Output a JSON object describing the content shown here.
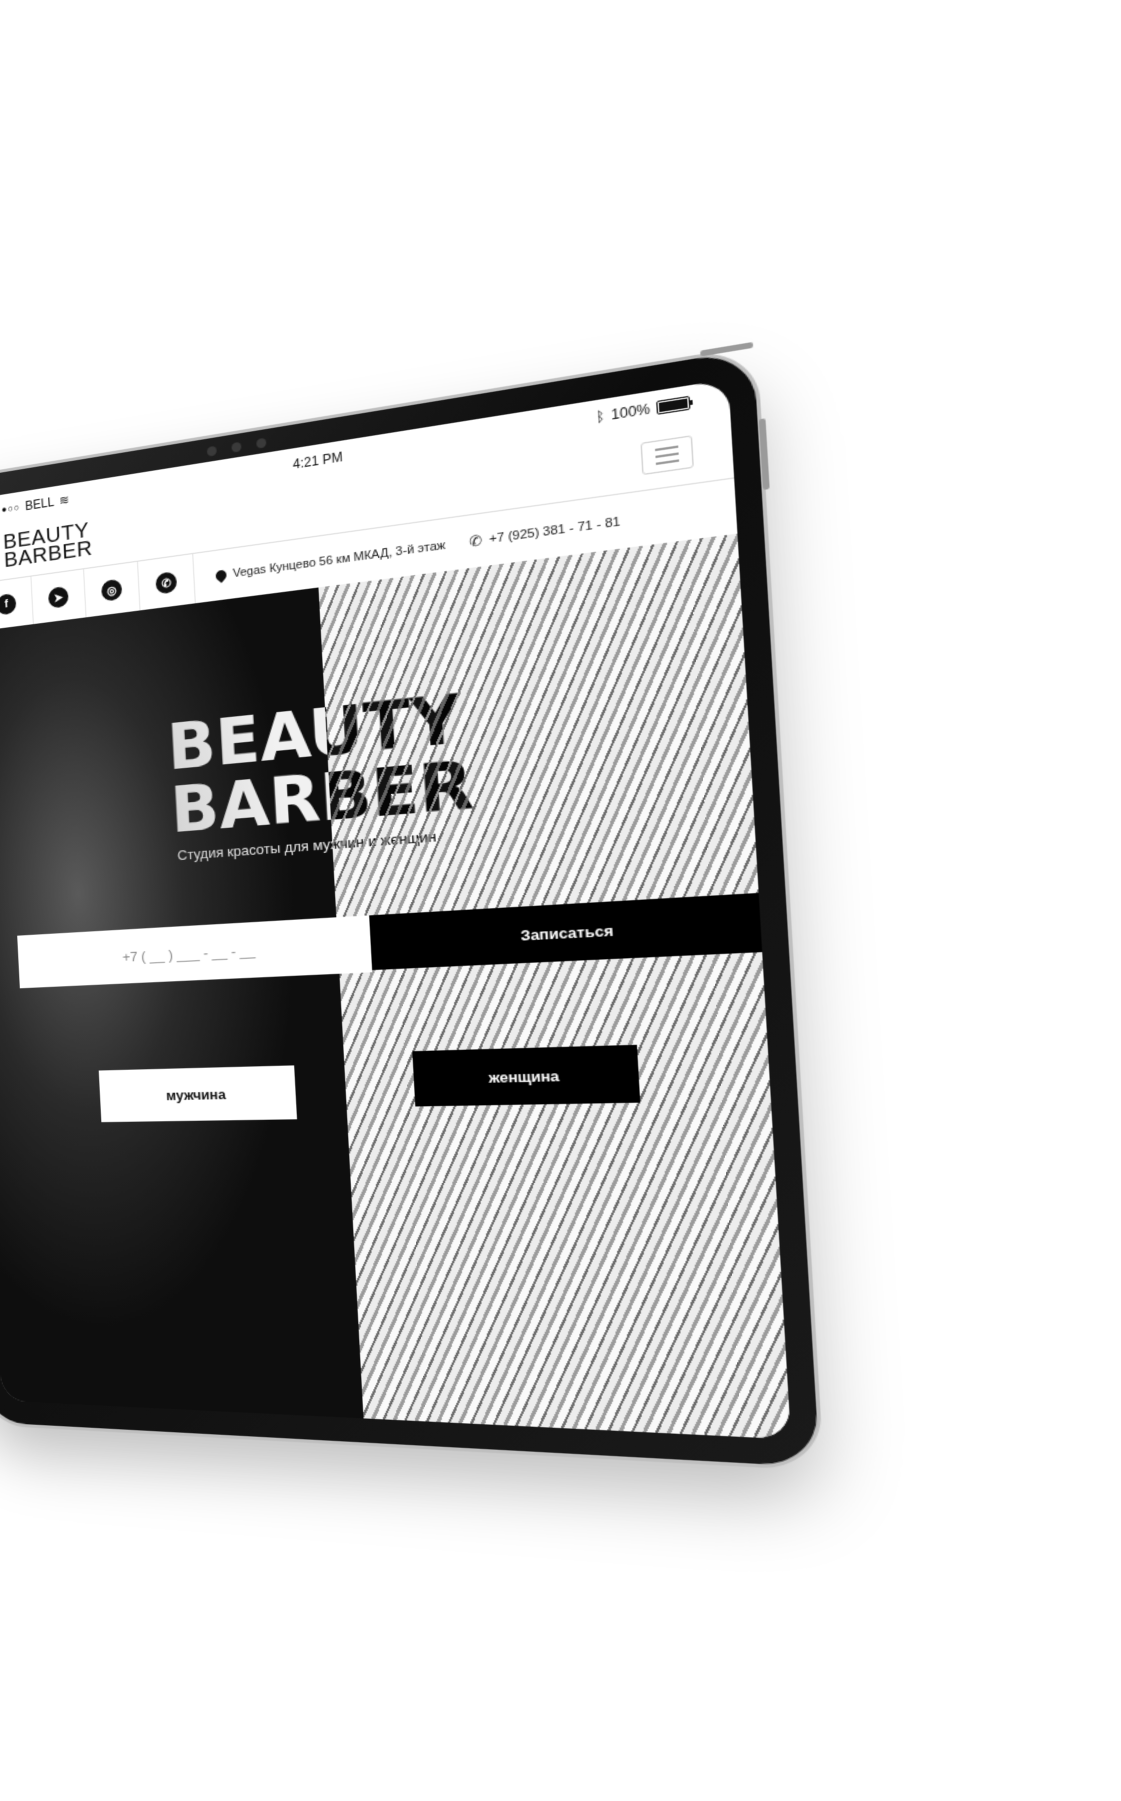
{
  "status_bar": {
    "carrier": "BELL",
    "time": "4:21 PM",
    "battery": "100%"
  },
  "header": {
    "logo_line1": "BEAUTY",
    "logo_line2": "BARBER"
  },
  "info_bar": {
    "socials": [
      {
        "icon": "facebook-icon",
        "glyph": "f"
      },
      {
        "icon": "telegram-icon",
        "glyph": "➤"
      },
      {
        "icon": "instagram-icon",
        "glyph": "◎"
      },
      {
        "icon": "whatsapp-icon",
        "glyph": "✆"
      }
    ],
    "address": "Vegas Кунцево 56 км МКАД, 3-й этаж",
    "phone": "+7 (925) 381 - 71 - 81"
  },
  "hero": {
    "title_line1": "BEAUTY",
    "title_line2": "BARBER",
    "subtitle": "Студия красоты для мужчин и женщин",
    "phone_placeholder": "+7 ( __ ) ___ - __ - __",
    "submit_label": "Записаться",
    "men_label": "мужчина",
    "women_label": "женщина"
  }
}
